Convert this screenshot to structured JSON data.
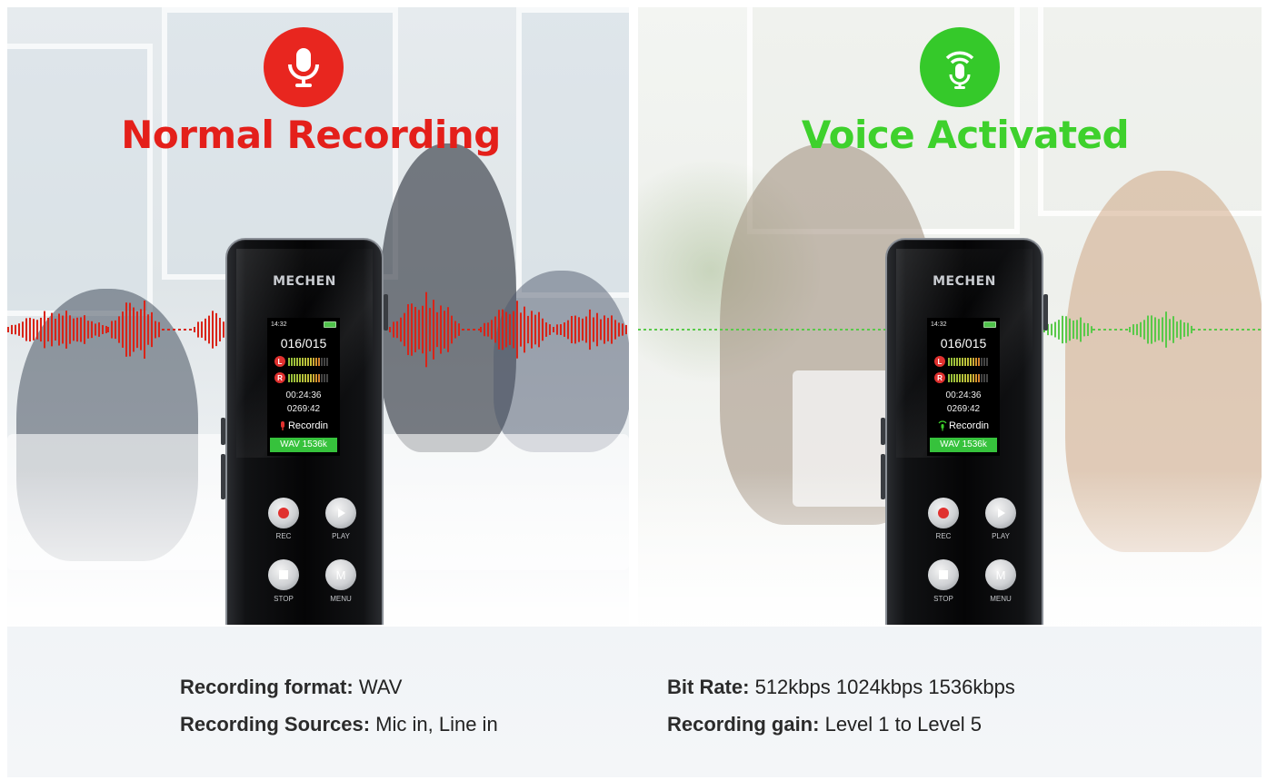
{
  "left_panel": {
    "title": "Normal Recording",
    "title_color": "#e41f1a",
    "icon": "microphone-icon",
    "icon_bg": "#e8261f",
    "wave_color": "#d92418"
  },
  "right_panel": {
    "title": "Voice Activated",
    "title_color": "#3ed12c",
    "icon": "voice-activated-microphone-icon",
    "icon_bg": "#35c92a",
    "wave_color": "#59c94a"
  },
  "device": {
    "brand": "MECHEN",
    "clock": "14:32",
    "file_counter": "016/015",
    "channel_left": "L",
    "channel_right": "R",
    "elapsed": "00:24:36",
    "remaining": "0269:42",
    "status": "Recordin",
    "format_bar": "WAV 1536k",
    "buttons": {
      "rec": "REC",
      "play": "PLAY",
      "stop": "STOP",
      "menu": "MENU",
      "menu_glyph": "M"
    }
  },
  "specs": {
    "format_label": "Recording format:",
    "format_value": "WAV",
    "sources_label": "Recording Sources:",
    "sources_value": "Mic in, Line in",
    "bitrate_label": "Bit Rate:",
    "bitrate_value": "512kbps 1024kbps 1536kbps",
    "gain_label": "Recording gain:",
    "gain_value": "Level 1 to Level 5"
  }
}
